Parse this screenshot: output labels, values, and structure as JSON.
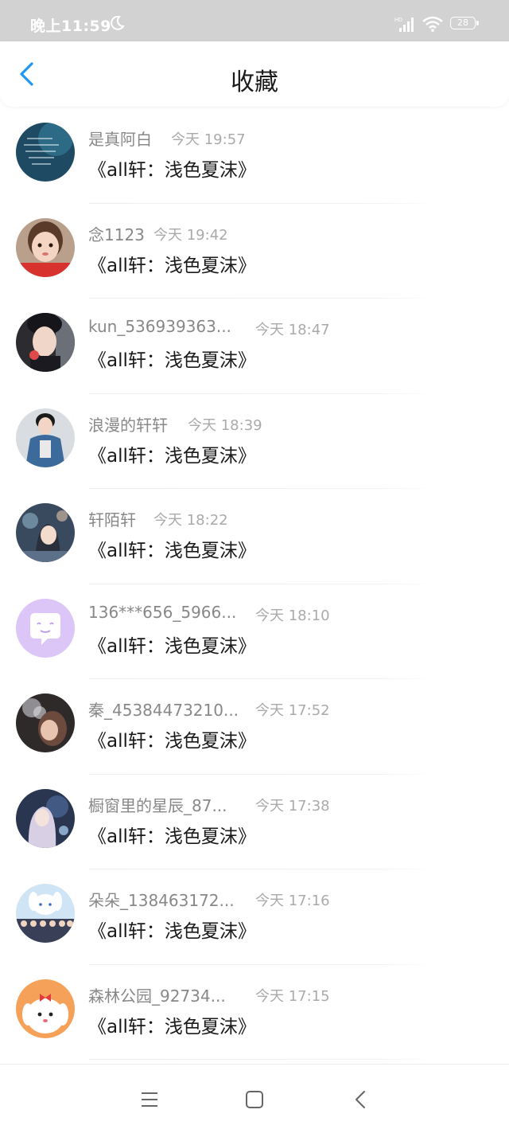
{
  "status_bar": {
    "time": "晚上11:59",
    "battery": "28",
    "icons": [
      "moon-icon",
      "hd-signal-icon",
      "wifi-icon",
      "battery-icon"
    ]
  },
  "header": {
    "title": "收藏",
    "back_icon": "chevron-left-icon",
    "accent_color": "#2196f3"
  },
  "favorites": [
    {
      "user": "是真阿白",
      "time": "今天 19:57",
      "title": "《all轩：浅色夏沫》"
    },
    {
      "user": "念1123",
      "time": "今天 19:42",
      "title": "《all轩：浅色夏沫》"
    },
    {
      "user": "kun_536939363...",
      "time": "今天 18:47",
      "title": "《all轩：浅色夏沫》"
    },
    {
      "user": "浪漫的轩轩",
      "time": "今天 18:39",
      "title": "《all轩：浅色夏沫》"
    },
    {
      "user": "轩陌轩",
      "time": "今天 18:22",
      "title": "《all轩：浅色夏沫》"
    },
    {
      "user": "136***656_5966...",
      "time": "今天 18:10",
      "title": "《all轩：浅色夏沫》"
    },
    {
      "user": "秦_45384473210...",
      "time": "今天 17:52",
      "title": "《all轩：浅色夏沫》"
    },
    {
      "user": "橱窗里的星辰_87...",
      "time": "今天 17:38",
      "title": "《all轩：浅色夏沫》"
    },
    {
      "user": "朵朵_138463172...",
      "time": "今天 17:16",
      "title": "《all轩：浅色夏沫》"
    },
    {
      "user": "森林公园_92734...",
      "time": "今天 17:15",
      "title": "《all轩：浅色夏沫》"
    }
  ],
  "system_nav": {
    "icons": [
      "menu-icon",
      "home-square-icon",
      "back-triangle-icon"
    ]
  }
}
